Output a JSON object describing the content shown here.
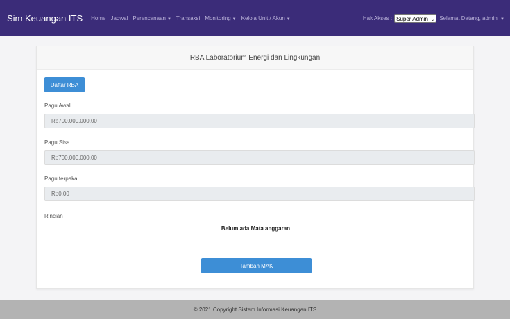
{
  "navbar": {
    "brand": "Sim Keuangan ITS",
    "items": [
      {
        "label": "Home",
        "dropdown": false
      },
      {
        "label": "Jadwal",
        "dropdown": false
      },
      {
        "label": "Perencanaan",
        "dropdown": true
      },
      {
        "label": "Transaksi",
        "dropdown": false
      },
      {
        "label": "Monitoring",
        "dropdown": true
      },
      {
        "label": "Kelola Unit / Akun",
        "dropdown": true
      }
    ],
    "hak_akses_label": "Hak Akses :",
    "role_selected": "Super Admin",
    "welcome": "Selamat Datang, admin"
  },
  "card": {
    "title": "RBA Laboratorium Energi dan Lingkungan",
    "daftar_button": "Daftar RBA",
    "fields": [
      {
        "label": "Pagu Awal",
        "value": "Rp700.000.000,00"
      },
      {
        "label": "Pagu Sisa",
        "value": "Rp700.000.000,00"
      },
      {
        "label": "Pagu terpakai",
        "value": "Rp0,00"
      }
    ],
    "rincian_label": "Rincian",
    "empty_message": "Belum ada Mata anggaran",
    "tambah_button": "Tambah MAK"
  },
  "footer": {
    "text": "© 2021 Copyright Sistem Informasi Keuangan ITS"
  },
  "colors": {
    "navbar_bg": "#3b2c79",
    "primary_button": "#3d8ed6",
    "footer_bg": "#b3b3b3"
  }
}
